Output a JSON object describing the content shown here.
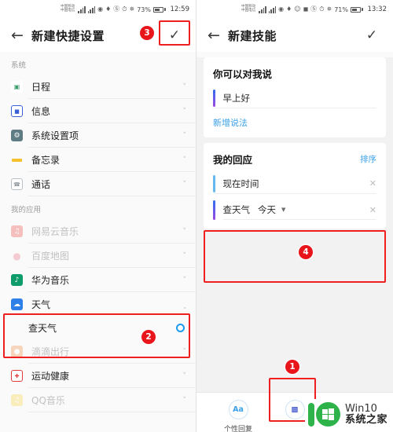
{
  "left": {
    "statusbar": {
      "carrier1": "中国移动",
      "carrier2": "中国电信",
      "battery_pct": "73%",
      "time": "12:59"
    },
    "appbar": {
      "title": "新建快捷设置",
      "back_icon": "back-arrow-icon",
      "confirm_icon": "check-icon"
    },
    "sections": [
      {
        "title": "系统",
        "items": [
          {
            "label": "日程",
            "icon": "calendar-icon",
            "color": "#3f9e6e",
            "dim": false
          },
          {
            "label": "信息",
            "icon": "message-icon",
            "color": "#3b5fd6",
            "dim": false
          },
          {
            "label": "系统设置项",
            "icon": "gear-icon",
            "color": "#5f7b84",
            "dim": false
          },
          {
            "label": "备忘录",
            "icon": "memo-icon",
            "color": "#f5c02b",
            "dim": false
          },
          {
            "label": "通话",
            "icon": "phone-icon",
            "color": "#9aa3ab",
            "dim": false
          }
        ]
      },
      {
        "title": "我的应用",
        "items": [
          {
            "label": "网易云音乐",
            "icon": "netease-music-icon",
            "color": "#e8453c",
            "dim": true
          },
          {
            "label": "百度地图",
            "icon": "map-pin-icon",
            "color": "#e86a7a",
            "dim": true
          },
          {
            "label": "华为音乐",
            "icon": "huawei-music-icon",
            "color": "#0e9c6b",
            "dim": false
          },
          {
            "label": "天气",
            "icon": "weather-cloud-icon",
            "color": "#2f7fe8",
            "dim": false,
            "expanded": true,
            "children": [
              {
                "label": "查天气",
                "selected": true
              }
            ]
          },
          {
            "label": "滴滴出行",
            "icon": "didi-icon",
            "color": "#f08a3c",
            "dim": true
          },
          {
            "label": "运动健康",
            "icon": "health-icon",
            "color": "#e03a3a",
            "dim": false
          },
          {
            "label": "QQ音乐",
            "icon": "qq-music-icon",
            "color": "#f5d33a",
            "dim": true
          }
        ]
      }
    ],
    "annotations": [
      {
        "number": "2"
      },
      {
        "number": "3"
      }
    ]
  },
  "right": {
    "statusbar": {
      "carrier1": "中国移动",
      "carrier2": "中国电信",
      "battery_pct": "71%",
      "time": "13:32"
    },
    "appbar": {
      "title": "新建技能",
      "back_icon": "back-arrow-icon",
      "confirm_icon": "check-icon"
    },
    "say_card": {
      "title": "你可以对我说",
      "phrase": "早上好",
      "add_link": "新增说法"
    },
    "reply_card": {
      "title": "我的回应",
      "sort_link": "排序",
      "items": [
        {
          "label": "现在时间",
          "close_icon": "close-icon",
          "highlighted": false
        },
        {
          "label": "查天气",
          "param": "今天",
          "caret_icon": "chevron-down-icon",
          "close_icon": "close-icon",
          "highlighted": true,
          "blurred_value": true
        }
      ]
    },
    "toolbar": [
      {
        "label": "个性回复",
        "glyph": "Aa",
        "icon": "text-reply-icon",
        "highlighted": false
      },
      {
        "label": "",
        "glyph": "",
        "icon": "skill-card-icon",
        "highlighted": true
      },
      {
        "label": "",
        "glyph": "",
        "icon": "more-icon",
        "highlighted": false
      }
    ],
    "annotations": [
      {
        "number": "1"
      },
      {
        "number": "4"
      }
    ]
  },
  "watermark": {
    "line1": "Win10",
    "line2": "系统之家",
    "icon": "win10-logo-icon"
  }
}
